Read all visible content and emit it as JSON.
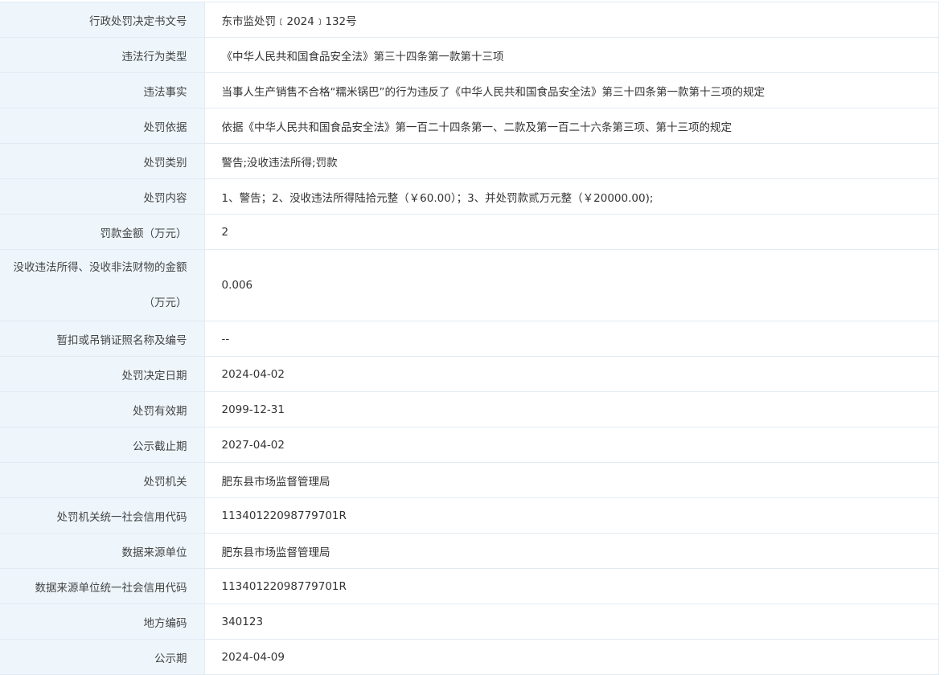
{
  "rows": [
    {
      "label": "行政处罚决定书文号",
      "value": "东市监处罚﹝2024﹞132号"
    },
    {
      "label": "违法行为类型",
      "value": "《中华人民共和国食品安全法》第三十四条第一款第十三项"
    },
    {
      "label": "违法事实",
      "value": "当事人生产销售不合格“糯米锅巴”的行为违反了《中华人民共和国食品安全法》第三十四条第一款第十三项的规定"
    },
    {
      "label": "处罚依据",
      "value": "依据《中华人民共和国食品安全法》第一百二十四条第一、二款及第一百二十六条第三项、第十三项的规定"
    },
    {
      "label": "处罚类别",
      "value": "警告;没收违法所得;罚款"
    },
    {
      "label": "处罚内容",
      "value": "1、警告；2、没收违法所得陆拾元整（￥60.00）；3、并处罚款贰万元整（￥20000.00);"
    },
    {
      "label": "罚款金额（万元）",
      "value": "2"
    },
    {
      "label": "没收违法所得、没收非法财物的金额（万元）",
      "value": "0.006"
    },
    {
      "label": "暂扣或吊销证照名称及编号",
      "value": "--"
    },
    {
      "label": "处罚决定日期",
      "value": "2024-04-02"
    },
    {
      "label": "处罚有效期",
      "value": "2099-12-31"
    },
    {
      "label": "公示截止期",
      "value": "2027-04-02"
    },
    {
      "label": "处罚机关",
      "value": "肥东县市场监督管理局"
    },
    {
      "label": "处罚机关统一社会信用代码",
      "value": "11340122098779701R"
    },
    {
      "label": "数据来源单位",
      "value": "肥东县市场监督管理局"
    },
    {
      "label": "数据来源单位统一社会信用代码",
      "value": "11340122098779701R"
    },
    {
      "label": "地方编码",
      "value": "340123"
    },
    {
      "label": "公示期",
      "value": "2024-04-09"
    }
  ]
}
